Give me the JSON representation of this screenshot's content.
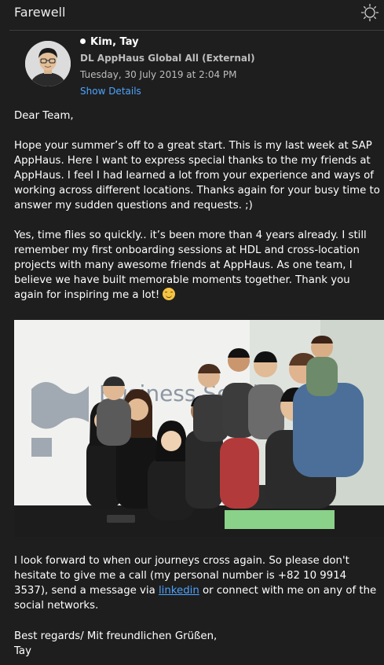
{
  "window": {
    "title": "Farewell"
  },
  "header": {
    "sender": "Kim, Tay",
    "recipient": "DL AppHaus Global All (External)",
    "date": "Tuesday, 30 July 2019 at 2:04 PM",
    "show_details": "Show Details"
  },
  "message": {
    "greeting": "Dear Team,",
    "para1": "Hope your summer’s off to a great start. This is my last week at SAP AppHaus. Here I want to express special thanks to the my friends at AppHaus. I feel I had learned a lot from your experience and ways of working across different locations. Thanks again for your busy time to answer my sudden questions and requests. ;)",
    "para2": "Yes, time flies so quickly.. it’s been more than 4 years already. I still remember my first onboarding sessions at HDL and cross-location projects with many awesome friends at AppHaus. As one team, I believe we have built memorable moments together. Thank you again for inspiring me a lot!",
    "para3_before": "I look forward to when our journeys cross again. So please don't hesitate to give me a call (my personal number is +82 10 9914 3537), send a message via ",
    "para3_link": "linkedin",
    "para3_after": " or connect with me on any of the social networks.",
    "signoff": "Best regards/ Mit freundlichen Grüßen,",
    "signature": "Tay"
  },
  "photo": {
    "wall_text": "Business Services"
  },
  "icons": {
    "appearance": "sun-icon",
    "sender_dot": "unread-dot-icon",
    "emoji": "smiling-face-emoji"
  },
  "colors": {
    "background": "#1e1e1e",
    "text": "#ffffff",
    "secondary_text": "#bdbdbd",
    "link": "#4ea4ff",
    "emoji": "#f6c343"
  }
}
